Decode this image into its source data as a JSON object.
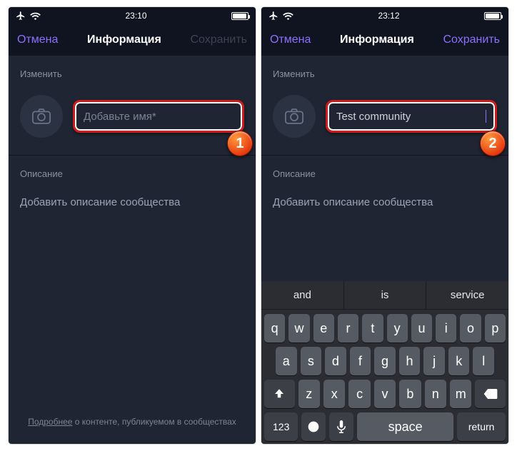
{
  "screens": {
    "left": {
      "status_time": "23:10",
      "nav_cancel": "Отмена",
      "nav_title": "Информация",
      "nav_save": "Сохранить",
      "section_change": "Изменить",
      "name_placeholder": "Добавьте имя*",
      "name_value": "",
      "section_desc_label": "Описание",
      "desc_placeholder": "Добавить описание сообщества",
      "footer_link": "Подробнее",
      "footer_rest": " о контенте, публикуемом в сообществах",
      "step_badge": "1"
    },
    "right": {
      "status_time": "23:12",
      "nav_cancel": "Отмена",
      "nav_title": "Информация",
      "nav_save": "Сохранить",
      "section_change": "Изменить",
      "name_value": "Test community",
      "section_desc_label": "Описание",
      "desc_placeholder": "Добавить описание сообщества",
      "step_badge": "2",
      "suggestions": [
        "and",
        "is",
        "service"
      ],
      "keys_row1": [
        "q",
        "w",
        "e",
        "r",
        "t",
        "y",
        "u",
        "i",
        "o",
        "p"
      ],
      "keys_row2": [
        "a",
        "s",
        "d",
        "f",
        "g",
        "h",
        "j",
        "k",
        "l"
      ],
      "keys_row3": [
        "z",
        "x",
        "c",
        "v",
        "b",
        "n",
        "m"
      ],
      "key_123": "123",
      "key_space": "space",
      "key_return": "return"
    }
  }
}
